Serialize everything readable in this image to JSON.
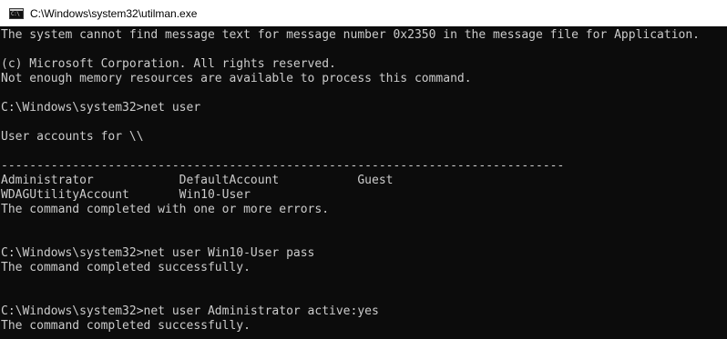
{
  "window": {
    "title": "C:\\Windows\\system32\\utilman.exe",
    "icon": "console-icon"
  },
  "console": {
    "lines": [
      "The system cannot find message text for message number 0x2350 in the message file for Application.",
      "",
      "(c) Microsoft Corporation. All rights reserved.",
      "Not enough memory resources are available to process this command.",
      "",
      "C:\\Windows\\system32>net user",
      "",
      "User accounts for \\\\",
      "",
      "-------------------------------------------------------------------------------",
      "Administrator            DefaultAccount           Guest",
      "WDAGUtilityAccount       Win10-User",
      "The command completed with one or more errors.",
      "",
      "",
      "C:\\Windows\\system32>net user Win10-User pass",
      "The command completed successfully.",
      "",
      "",
      "C:\\Windows\\system32>net user Administrator active:yes",
      "The command completed successfully."
    ]
  },
  "colors": {
    "background": "#0c0c0c",
    "text": "#cccccc",
    "titlebar": "#ffffff"
  }
}
